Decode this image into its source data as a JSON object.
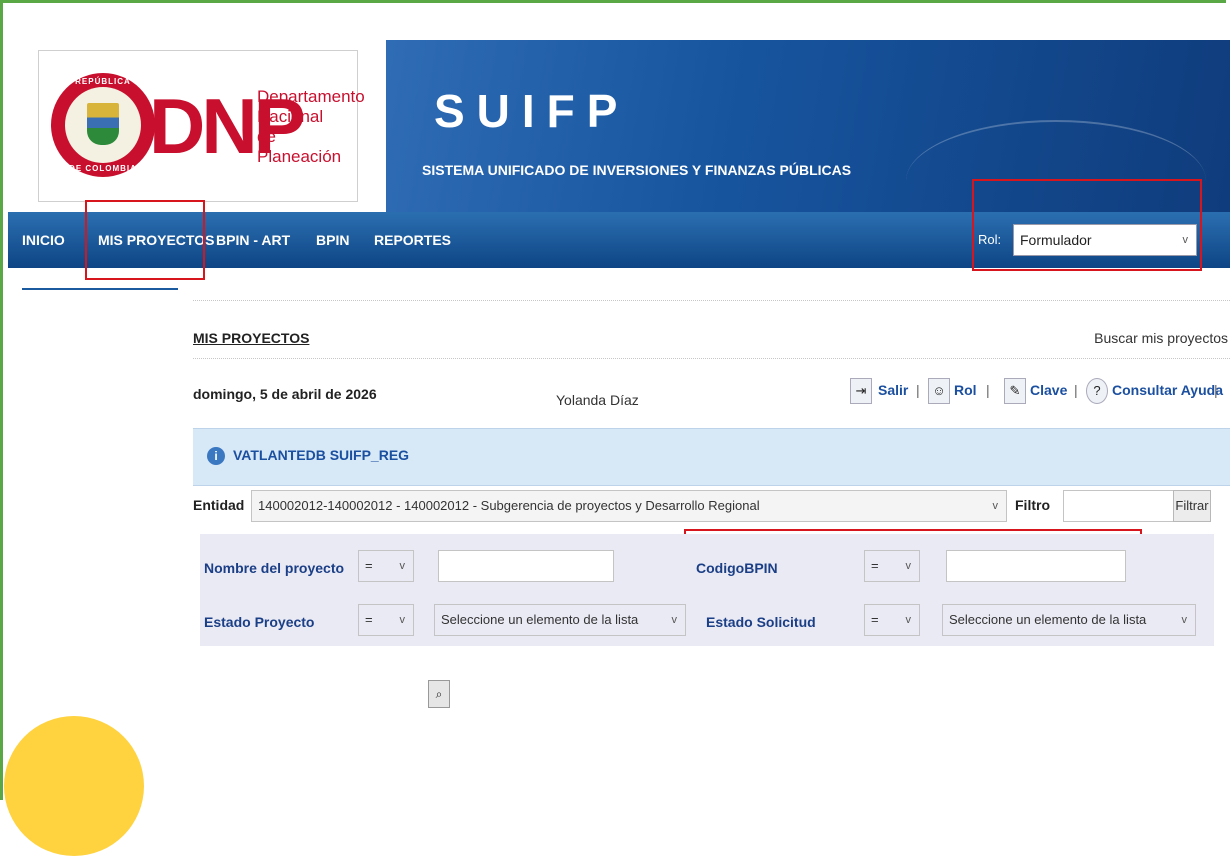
{
  "header": {
    "seal_top": "REPÚBLICA",
    "seal_bottom": "DE COLOMBIA",
    "dnp_mark": "DNP",
    "dnp_line1": "Departamento",
    "dnp_line2": "Nacional",
    "dnp_line3": "de Planeación",
    "app_title": "SUIFP",
    "app_subtitle": "SISTEMA UNIFICADO DE INVERSIONES Y FINANZAS PÚBLICAS"
  },
  "nav": {
    "items": [
      "INICIO",
      "MIS PROYECTOS",
      "BPIN - ART",
      "BPIN",
      "REPORTES"
    ],
    "rol_label": "Rol:",
    "rol_value": "Formulador"
  },
  "page": {
    "section_title": "MIS PROYECTOS",
    "search_link": "Buscar mis proyectos",
    "date": "domingo, 5 de abril de 2026",
    "user": "Yolanda Díaz"
  },
  "toolbar": {
    "salir": "Salir",
    "rol": "Rol",
    "clave": "Clave",
    "ayuda": "Consultar Ayuda",
    "sep": "|"
  },
  "info": {
    "text": "VATLANTEDB SUIFP_REG",
    "icon": "i"
  },
  "entidad": {
    "label": "Entidad",
    "value": "140002012-140002012 - 140002012 - Subgerencia de proyectos y Desarrollo Regional",
    "filtro_label": "Filtro",
    "filtrar_button": "Filtrar"
  },
  "filters": {
    "nombre_label": "Nombre del proyecto",
    "codigo_label": "CodigoBPIN",
    "estado_proyecto_label": "Estado Proyecto",
    "estado_solicitud_label": "Estado Solicitud",
    "operator": "=",
    "list_placeholder": "Seleccione un elemento de la lista"
  },
  "icons": {
    "chevron": "v"
  },
  "colors": {
    "nav_blue": "#0e4585",
    "highlight_red": "#d6161c",
    "frame_green": "#5aa845",
    "info_bg": "#d7e8f6"
  }
}
